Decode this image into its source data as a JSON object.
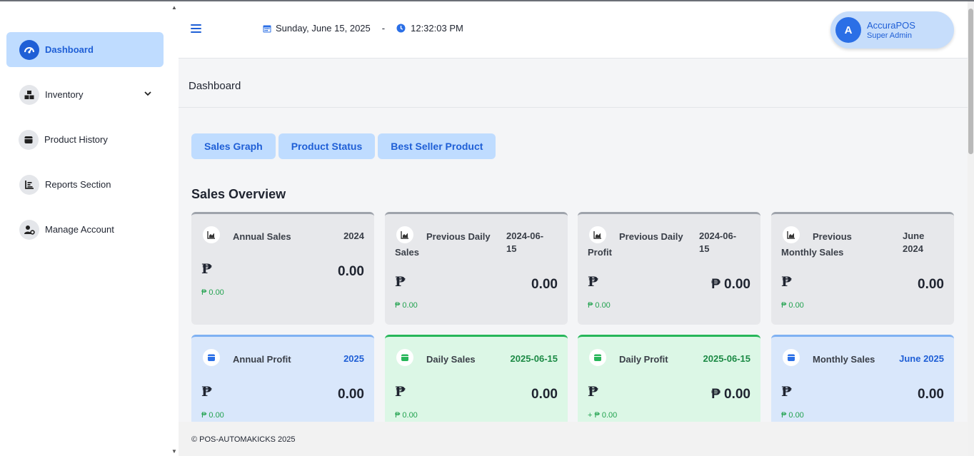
{
  "sidebar": {
    "items": [
      {
        "label": "Dashboard",
        "icon": "gauge-icon"
      },
      {
        "label": "Inventory",
        "icon": "boxes-icon"
      },
      {
        "label": "Product History",
        "icon": "archive-icon"
      },
      {
        "label": "Reports Section",
        "icon": "chart-icon"
      },
      {
        "label": "Manage Account",
        "icon": "user-gear-icon"
      }
    ]
  },
  "header": {
    "date": "Sunday, June 15, 2025",
    "separator": "-",
    "time": "12:32:03 PM",
    "user": {
      "initial": "A",
      "name": "AccuraPOS",
      "role": "Super Admin"
    }
  },
  "page": {
    "title": "Dashboard"
  },
  "tabs": [
    {
      "label": "Sales Graph"
    },
    {
      "label": "Product Status"
    },
    {
      "label": "Best Seller Product"
    }
  ],
  "section_title": "Sales Overview",
  "cards": [
    {
      "title": "Annual Sales",
      "period": "2024",
      "peso": "₱",
      "value": "0.00",
      "sub": "₱ 0.00"
    },
    {
      "title": "Previous Daily Sales",
      "period": "2024-06-15",
      "peso": "₱",
      "value": "0.00",
      "sub": "₱ 0.00"
    },
    {
      "title": "Previous Daily Profit",
      "period": "2024-06-15",
      "peso": "₱",
      "value": "₱ 0.00",
      "sub": "₱ 0.00"
    },
    {
      "title": "Previous Monthly Sales",
      "period": "June 2024",
      "peso": "₱",
      "value": "0.00",
      "sub": "₱ 0.00"
    },
    {
      "title": "Annual Profit",
      "period": "2025",
      "peso": "₱",
      "value": "0.00",
      "sub": "₱ 0.00"
    },
    {
      "title": "Daily Sales",
      "period": "2025-06-15",
      "peso": "₱",
      "value": "0.00",
      "sub": "₱ 0.00"
    },
    {
      "title": "Daily Profit",
      "period": "2025-06-15",
      "peso": "₱",
      "value": "₱ 0.00",
      "sub": "+ ₱ 0.00"
    },
    {
      "title": "Monthly Sales",
      "period": "June 2025",
      "peso": "₱",
      "value": "0.00",
      "sub": "₱ 0.00"
    }
  ],
  "footer": {
    "text": "© POS-AUTOMAKICKS 2025"
  },
  "colors": {
    "accent": "#1f5fd6",
    "active_bg": "#bfdcff",
    "gray_card": "#e7e8eb",
    "blue_card": "#d9e7fb",
    "green_card": "#dcf7e6",
    "green_text": "#22a24f"
  }
}
